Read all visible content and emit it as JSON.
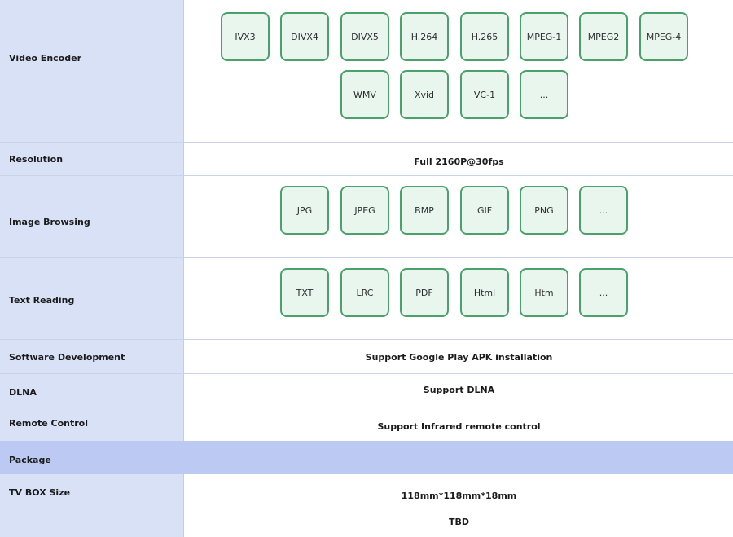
{
  "rows": {
    "video_encoder": {
      "label": "Video Encoder",
      "formats": [
        "IVX3",
        "DIVX4",
        "DIVX5",
        "H.264",
        "H.265",
        "MPEG-1",
        "MPEG2",
        "MPEG-4",
        "WMV",
        "Xvid",
        "VC-1",
        "..."
      ]
    },
    "resolution": {
      "label": "Resolution",
      "value": "Full 2160P@30fps"
    },
    "image_browsing": {
      "label": "Image Browsing",
      "formats": [
        "JPG",
        "JPEG",
        "BMP",
        "GIF",
        "PNG",
        "..."
      ]
    },
    "text_reading": {
      "label": "Text Reading",
      "formats": [
        "TXT",
        "LRC",
        "PDF",
        "Html",
        "Htm",
        "..."
      ]
    },
    "software_development": {
      "label": "Software Development",
      "value": "Support Google Play APK installation"
    },
    "dlna": {
      "label": "DLNA",
      "value": "Support DLNA"
    },
    "remote_control": {
      "label": "Remote Control",
      "value": "Support Infrared remote control"
    },
    "package": {
      "label": "Package"
    },
    "tv_box_size": {
      "label": "TV BOX Size",
      "value": "118mm*118mm*18mm"
    },
    "last": {
      "label": "",
      "value": "TBD"
    }
  }
}
